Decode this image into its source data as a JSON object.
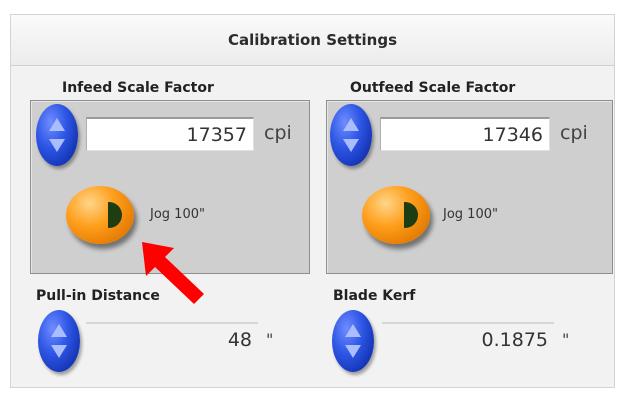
{
  "header": {
    "title": "Calibration Settings"
  },
  "infeed": {
    "label": "Infeed Scale Factor",
    "value": "17357",
    "unit": "cpi",
    "jog_label": "Jog 100\""
  },
  "outfeed": {
    "label": "Outfeed Scale Factor",
    "value": "17346",
    "unit": "cpi",
    "jog_label": "Jog 100\""
  },
  "pull_in": {
    "label": "Pull-in Distance",
    "value": "48",
    "unit": "\""
  },
  "blade_kerf": {
    "label": "Blade Kerf",
    "value": "0.1875",
    "unit": "\""
  },
  "icons": {
    "spinner": "up-down-spinner-icon",
    "jog": "jog-button-icon",
    "annotation": "red-arrow-icon"
  },
  "colors": {
    "spinner": "#2f57e6",
    "jog": "#ff9f1c",
    "annotation_arrow": "#ff0000"
  }
}
